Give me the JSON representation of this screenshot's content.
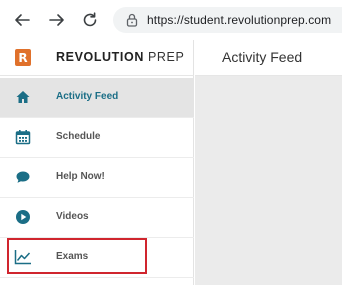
{
  "browser": {
    "url": "https://student.revolutionprep.com"
  },
  "brand": {
    "logo_letter": "R",
    "name_bold": "REVOLUTION",
    "name_light": "PREP",
    "logo_color": "#e0712b"
  },
  "sidebar": {
    "items": [
      {
        "label": "Activity Feed",
        "icon": "home-icon",
        "active": true
      },
      {
        "label": "Schedule",
        "icon": "calendar-icon",
        "active": false
      },
      {
        "label": "Help Now!",
        "icon": "chat-bubble-icon",
        "active": false
      },
      {
        "label": "Videos",
        "icon": "play-circle-icon",
        "active": false
      },
      {
        "label": "Exams",
        "icon": "line-chart-icon",
        "active": false,
        "highlighted": true
      }
    ]
  },
  "header": {
    "title": "Activity Feed"
  },
  "colors": {
    "accent": "#1b6e86",
    "highlight": "#d0252e"
  }
}
